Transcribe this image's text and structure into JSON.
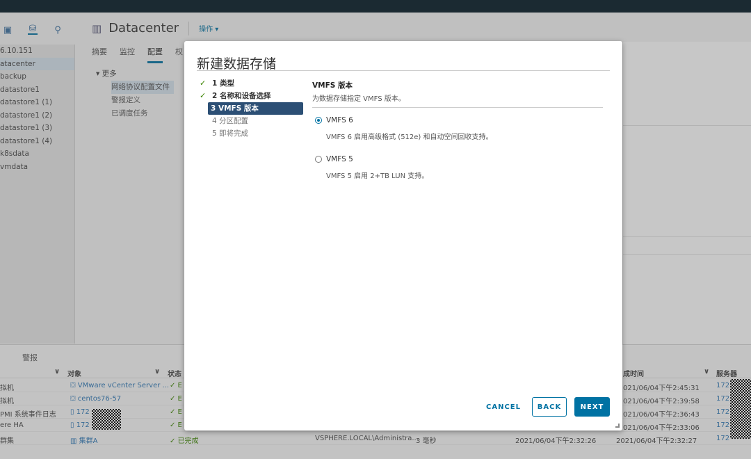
{
  "background": {
    "tree": [
      "6.10.151",
      "atacenter",
      "backup",
      "datastore1",
      "datastore1 (1)",
      "datastore1 (2)",
      "datastore1 (3)",
      "datastore1 (4)",
      "k8sdata",
      "vmdata"
    ],
    "header_title": "Datacenter",
    "header_actions": "操作 ▾",
    "tabs": [
      "摘要",
      "监控",
      "配置",
      "权"
    ],
    "more": "▾ 更多",
    "sub_items": [
      "网络协议配置文件",
      "警报定义",
      "已调度任务"
    ],
    "alerts_title": "警报",
    "alerts_cols": {
      "c1": "∨",
      "obj": "对象",
      "c3": "∨",
      "status": "状态",
      "time": "成时间",
      "c6": "∨",
      "server": "服务器"
    },
    "alert_rows": [
      {
        "name": "拟机",
        "obj": "VMware vCenter Server ...",
        "status": "✓ E",
        "time": "021/06/04下午2:45:31",
        "server": "172"
      },
      {
        "name": "拟机",
        "obj": "centos76-57",
        "status": "✓ E",
        "time": "021/06/04下午2:39:58",
        "server": "172"
      },
      {
        "name": "PMI 系统事件日志",
        "obj": "172",
        "status": "✓ E",
        "time": "021/06/04下午2:36:43",
        "server": "172"
      },
      {
        "name": "ere HA",
        "obj": "172",
        "status": "✓ E",
        "time": "021/06/04下午2:33:06",
        "server": "172"
      },
      {
        "name": "群集",
        "obj": "集群A",
        "status": "✓ 已完成",
        "user": "VSPHERE.LOCAL\\Administra...",
        "dur": "3 毫秒",
        "start": "2021/06/04下午2:32:26",
        "time": "2021/06/04下午2:32:27",
        "server": "172"
      }
    ]
  },
  "dialog": {
    "title": "新建数据存储",
    "steps": [
      {
        "label": "1 类型",
        "state": "done"
      },
      {
        "label": "2 名称和设备选择",
        "state": "done"
      },
      {
        "label": "3 VMFS 版本",
        "state": "active"
      },
      {
        "label": "4 分区配置",
        "state": "todo"
      },
      {
        "label": "5 即将完成",
        "state": "todo"
      }
    ],
    "section_title": "VMFS 版本",
    "section_subtitle": "为数据存储指定 VMFS 版本。",
    "options": [
      {
        "label": "VMFS 6",
        "desc": "VMFS 6 启用高级格式 (512e) 和自动空间回收支持。",
        "selected": true
      },
      {
        "label": "VMFS 5",
        "desc": "VMFS 5 启用 2+TB LUN 支持。",
        "selected": false
      }
    ],
    "buttons": {
      "cancel": "CANCEL",
      "back": "BACK",
      "next": "NEXT"
    }
  },
  "colors": {
    "accent": "#0072a3",
    "active_step": "#2c4f75",
    "check": "#3c8500"
  }
}
